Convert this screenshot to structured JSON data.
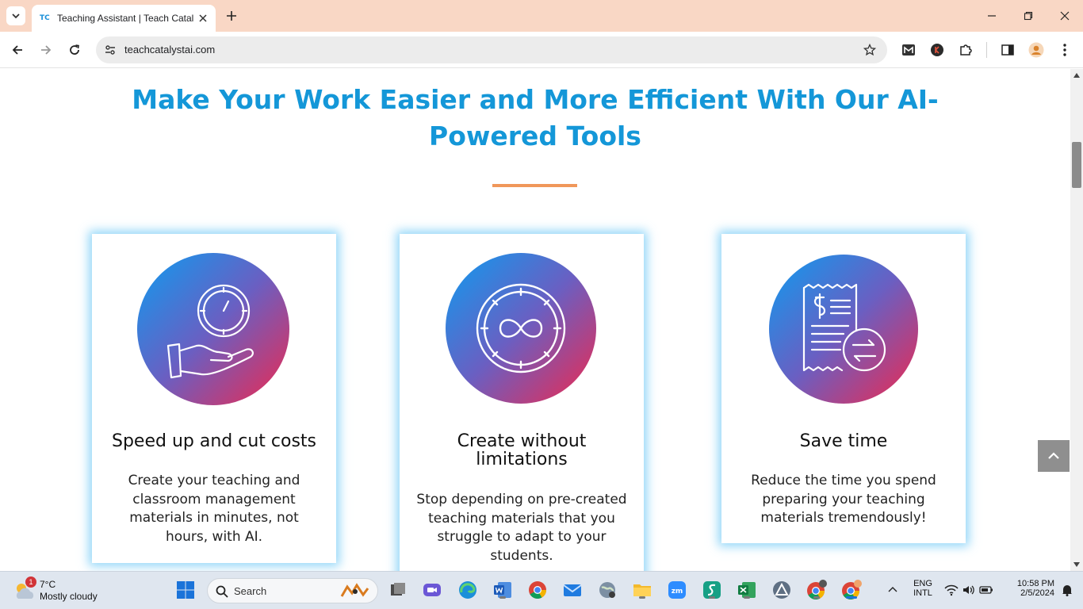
{
  "browser": {
    "tab_title": "Teaching Assistant | Teach Catal",
    "tab_favicon_text": "TC",
    "url": "teachcatalystai.com"
  },
  "page": {
    "headline": "Make Your Work Easier and More Efficient With Our AI-Powered Tools",
    "accent_color": "#1497d8",
    "divider_color": "#f0975a",
    "cards": [
      {
        "title": "Speed up and cut costs",
        "body": "Create your teaching and classroom management materials in minutes, not hours, with AI.",
        "icon": "hand-clock-icon"
      },
      {
        "title": "Create without limitations",
        "body": "Stop depending on pre-created teaching materials that you struggle to adapt to your students.",
        "icon": "infinity-clock-icon"
      },
      {
        "title": "Save time",
        "body": "Reduce the time you spend preparing your teaching materials tremendously!",
        "icon": "receipt-exchange-icon"
      }
    ]
  },
  "taskbar": {
    "weather_temp": "7°C",
    "weather_desc": "Mostly cloudy",
    "weather_badge": "1",
    "search_label": "Search",
    "language_line1": "ENG",
    "language_line2": "INTL",
    "time": "10:58 PM",
    "date": "2/5/2024"
  }
}
